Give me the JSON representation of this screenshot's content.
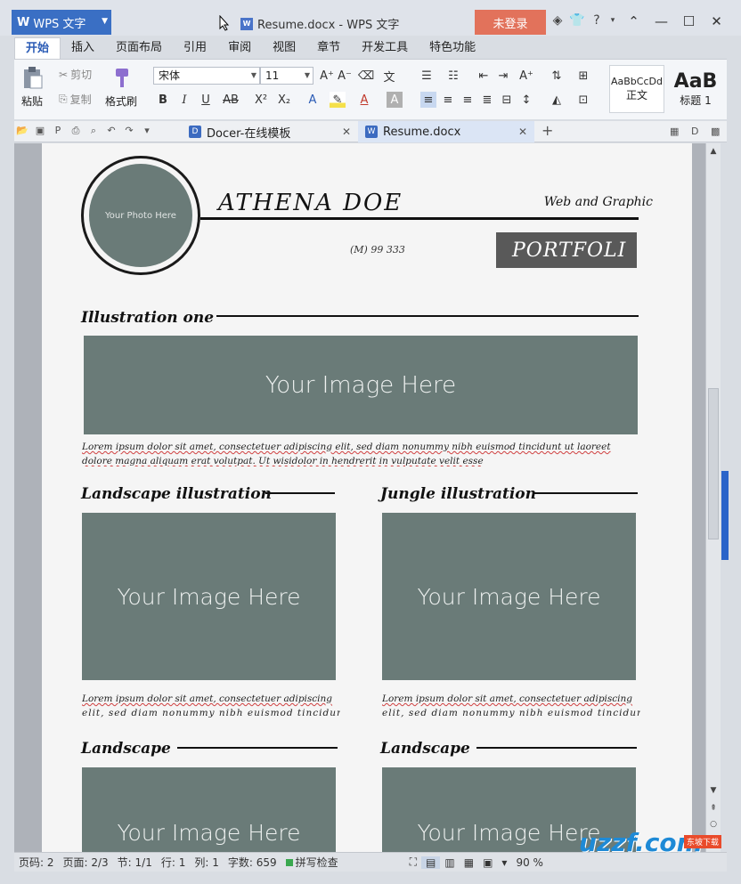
{
  "app": {
    "name": "WPS 文字",
    "window_title": "Resume.docx - WPS 文字",
    "login_label": "未登录"
  },
  "menu_tabs": [
    "开始",
    "插入",
    "页面布局",
    "引用",
    "审阅",
    "视图",
    "章节",
    "开发工具",
    "特色功能"
  ],
  "ribbon": {
    "paste": "粘贴",
    "cut": "剪切",
    "copy": "复制",
    "format_painter": "格式刷",
    "font_name": "宋体",
    "font_size": "11",
    "style_normal_preview": "AaBbCcDd",
    "style_normal": "正文",
    "style_heading_preview": "AaB",
    "style_heading": "标题 1"
  },
  "doc_tabs": [
    {
      "label": "Docer-在线模板",
      "active": false
    },
    {
      "label": "Resume.docx",
      "active": true
    }
  ],
  "document": {
    "photo_placeholder": "Your Photo Here",
    "name": "ATHENA DOE",
    "subtitle": "Web and Graphic",
    "phone": "(M) 99 333",
    "portfolio": "PORTFOLI",
    "section1_title": "Illustration one",
    "image_placeholder": "Your Image Here",
    "lorem_line1": "Lorem ipsum dolor sit amet, consectetuer adipiscing elit, sed diam nonummy nibh euismod tincidunt ut laoreet",
    "lorem_line2": "dolore magna aliquam erat volutpat. Ut wisidolor in hendrerit in vulputate velit esse",
    "section2_title": "Landscape illustration",
    "section3_title": "Jungle illustration",
    "col_lorem_line1": "Lorem ipsum dolor sit amet, consectetuer adipiscing",
    "col_lorem_line2": "elit, sed diam nonummy nibh euismod tincidunt",
    "section4_title": "Landscape",
    "section5_title": "Landscape"
  },
  "status_bar": {
    "page_no": "页码: 2",
    "pages": "页面: 2/3",
    "section": "节: 1/1",
    "line": "行: 1",
    "column": "列: 1",
    "word_count": "字数: 659",
    "spell_check": "拼写检查",
    "zoom": "90 %"
  },
  "watermark": {
    "logo": "uzzf.com",
    "badge": "东坡下载"
  }
}
